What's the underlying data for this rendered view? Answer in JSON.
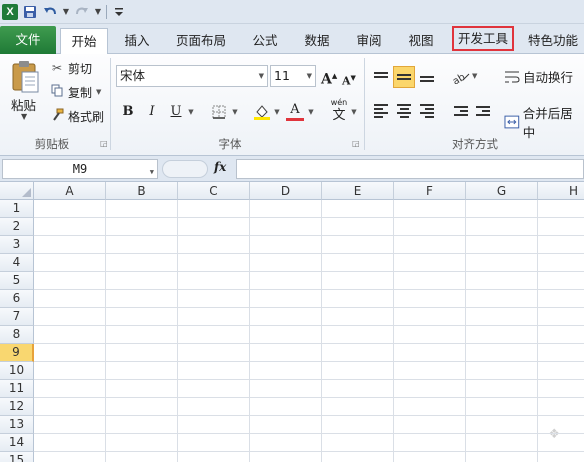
{
  "quick_access": {
    "app_icon": "X",
    "icons": [
      "excel-icon",
      "save-icon",
      "undo-icon",
      "redo-icon",
      "customize-icon"
    ]
  },
  "tabs": [
    {
      "label": "文件"
    },
    {
      "label": "开始"
    },
    {
      "label": "插入"
    },
    {
      "label": "页面布局"
    },
    {
      "label": "公式"
    },
    {
      "label": "数据"
    },
    {
      "label": "审阅"
    },
    {
      "label": "视图"
    },
    {
      "label": "开发工具"
    },
    {
      "label": "特色功能"
    }
  ],
  "ribbon": {
    "clipboard": {
      "paste": "粘贴",
      "cut": "剪切",
      "copy": "复制",
      "format_painter": "格式刷",
      "label": "剪贴板"
    },
    "font": {
      "name": "宋体",
      "size": "11",
      "grow": "A",
      "shrink": "A",
      "bold": "B",
      "italic": "I",
      "underline": "U",
      "font_color": "A",
      "phonetic": "wén",
      "phonetic_char": "文",
      "label": "字体"
    },
    "alignment": {
      "wrap_text": "自动换行",
      "merge_center": "合并后居中",
      "label": "对齐方式"
    }
  },
  "formula_bar": {
    "name_box": "M9",
    "fx": "fx"
  },
  "sheet": {
    "columns": [
      "A",
      "B",
      "C",
      "D",
      "E",
      "F",
      "G",
      "H"
    ],
    "rows": [
      "1",
      "2",
      "3",
      "4",
      "5",
      "6",
      "7",
      "8",
      "9",
      "10",
      "11",
      "12",
      "13",
      "14",
      "15"
    ],
    "selected_row": "9"
  },
  "colors": {
    "accent": "#1f7a36",
    "highlight": "#e0343c",
    "selection": "#f9d770"
  }
}
